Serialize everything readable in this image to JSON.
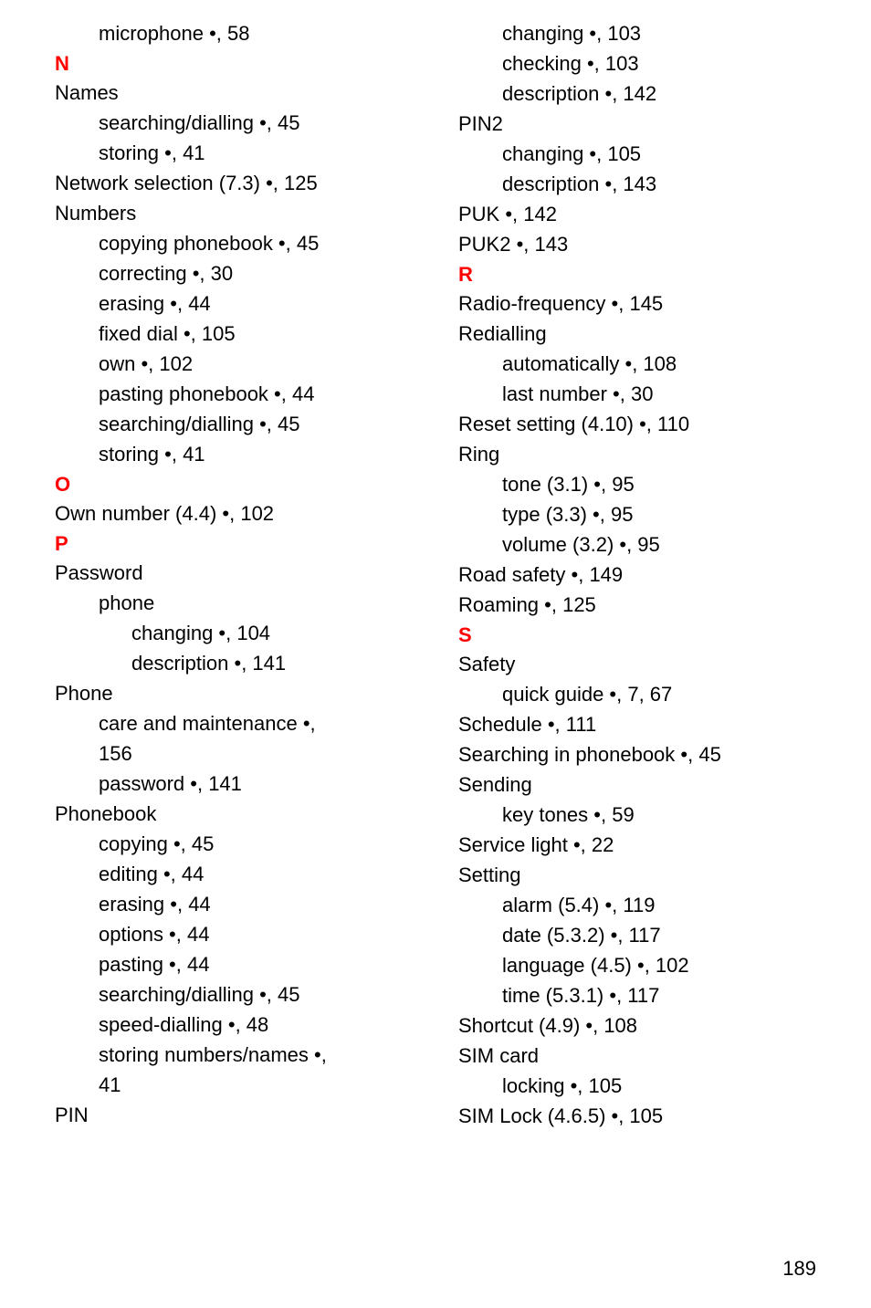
{
  "columns": [
    {
      "lines": [
        {
          "level": 1,
          "text": "microphone •, 58"
        },
        {
          "letter": "N"
        },
        {
          "level": 0,
          "text": "Names"
        },
        {
          "level": 1,
          "text": "searching/dialling •, 45"
        },
        {
          "level": 1,
          "text": "storing •, 41"
        },
        {
          "level": 0,
          "text": "Network selection (7.3) •, 125"
        },
        {
          "level": 0,
          "text": "Numbers"
        },
        {
          "level": 1,
          "text": "copying phonebook •, 45"
        },
        {
          "level": 1,
          "text": "correcting •, 30"
        },
        {
          "level": 1,
          "text": "erasing •, 44"
        },
        {
          "level": 1,
          "text": "fixed dial •, 105"
        },
        {
          "level": 1,
          "text": "own •, 102"
        },
        {
          "level": 1,
          "text": "pasting phonebook •, 44"
        },
        {
          "level": 1,
          "text": "searching/dialling •, 45"
        },
        {
          "level": 1,
          "text": "storing •, 41"
        },
        {
          "letter": "O"
        },
        {
          "level": 0,
          "text": "Own number (4.4) •, 102"
        },
        {
          "letter": "P"
        },
        {
          "level": 0,
          "text": "Password"
        },
        {
          "level": 1,
          "text": "phone"
        },
        {
          "level": 2,
          "text": "changing •, 104"
        },
        {
          "level": 2,
          "text": "description •, 141"
        },
        {
          "level": 0,
          "text": "Phone"
        },
        {
          "level": 1,
          "text": "care and maintenance •,"
        },
        {
          "level": 1,
          "text": "156"
        },
        {
          "level": 1,
          "text": "password •, 141"
        },
        {
          "level": 0,
          "text": "Phonebook"
        },
        {
          "level": 1,
          "text": "copying •, 45"
        },
        {
          "level": 1,
          "text": "editing •, 44"
        },
        {
          "level": 1,
          "text": "erasing •, 44"
        },
        {
          "level": 1,
          "text": "options •, 44"
        },
        {
          "level": 1,
          "text": "pasting •, 44"
        },
        {
          "level": 1,
          "text": "searching/dialling •, 45"
        },
        {
          "level": 1,
          "text": "speed-dialling •, 48"
        },
        {
          "level": 1,
          "text": "storing numbers/names •,"
        },
        {
          "level": 1,
          "text": "41"
        },
        {
          "level": 0,
          "text": "PIN"
        }
      ]
    },
    {
      "lines": [
        {
          "level": 1,
          "text": "changing •, 103"
        },
        {
          "level": 1,
          "text": "checking •, 103"
        },
        {
          "level": 1,
          "text": "description •, 142"
        },
        {
          "level": 0,
          "text": "PIN2"
        },
        {
          "level": 1,
          "text": "changing •, 105"
        },
        {
          "level": 1,
          "text": "description •, 143"
        },
        {
          "level": 0,
          "text": "PUK •, 142"
        },
        {
          "level": 0,
          "text": "PUK2 •, 143"
        },
        {
          "letter": "R"
        },
        {
          "level": 0,
          "text": "Radio-frequency •, 145"
        },
        {
          "level": 0,
          "text": "Redialling"
        },
        {
          "level": 1,
          "text": "automatically •, 108"
        },
        {
          "level": 1,
          "text": "last number •, 30"
        },
        {
          "level": 0,
          "text": "Reset setting (4.10) •, 110"
        },
        {
          "level": 0,
          "text": "Ring"
        },
        {
          "level": 1,
          "text": "tone (3.1) •, 95"
        },
        {
          "level": 1,
          "text": "type (3.3) •, 95"
        },
        {
          "level": 1,
          "text": "volume (3.2) •, 95"
        },
        {
          "level": 0,
          "text": "Road safety •, 149"
        },
        {
          "level": 0,
          "text": "Roaming •, 125"
        },
        {
          "letter": "S"
        },
        {
          "level": 0,
          "text": "Safety"
        },
        {
          "level": 1,
          "text": "quick guide •, 7, 67"
        },
        {
          "level": 0,
          "text": "Schedule •, 111"
        },
        {
          "level": 0,
          "text": "Searching in phonebook •, 45"
        },
        {
          "level": 0,
          "text": "Sending"
        },
        {
          "level": 1,
          "text": "key tones •, 59"
        },
        {
          "level": 0,
          "text": "Service light •, 22"
        },
        {
          "level": 0,
          "text": "Setting"
        },
        {
          "level": 1,
          "text": "alarm (5.4) •, 119"
        },
        {
          "level": 1,
          "text": "date (5.3.2) •, 117"
        },
        {
          "level": 1,
          "text": "language (4.5) •, 102"
        },
        {
          "level": 1,
          "text": "time (5.3.1) •, 117"
        },
        {
          "level": 0,
          "text": "Shortcut (4.9) •, 108"
        },
        {
          "level": 0,
          "text": "SIM card"
        },
        {
          "level": 1,
          "text": "locking •, 105"
        },
        {
          "level": 0,
          "text": "SIM Lock (4.6.5) •, 105"
        }
      ]
    }
  ],
  "pageNumber": "189"
}
